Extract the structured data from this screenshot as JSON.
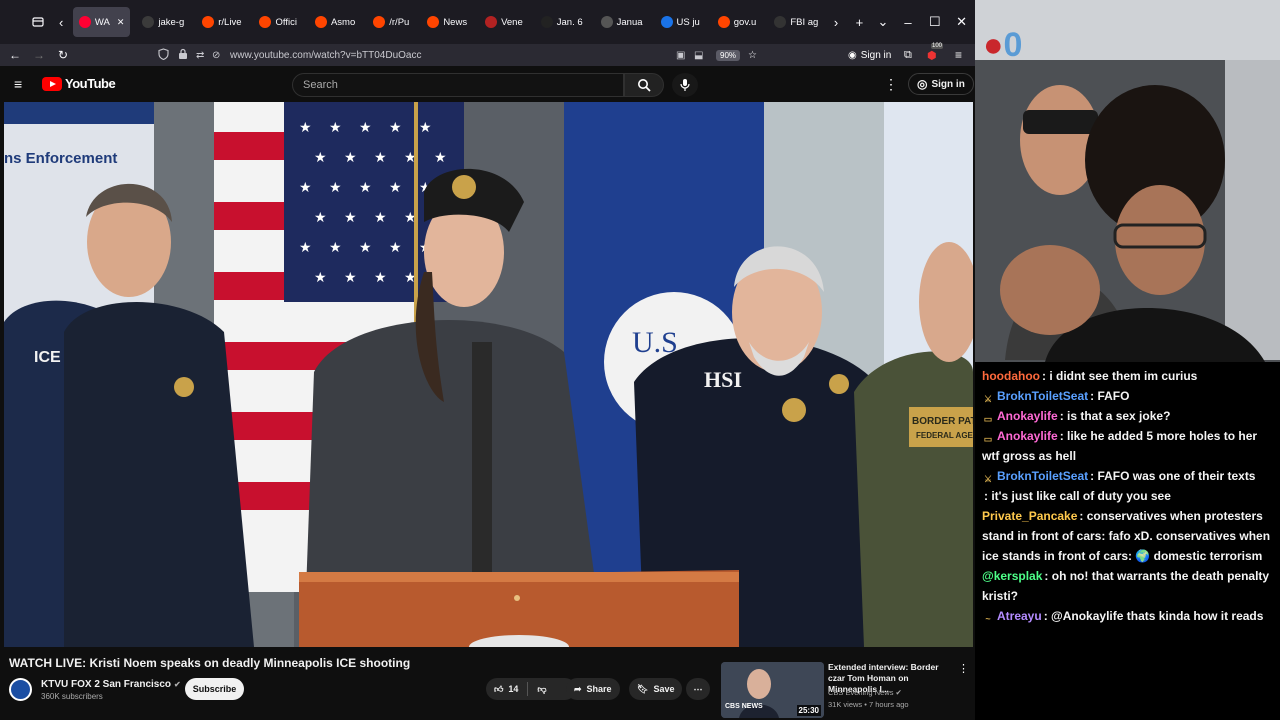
{
  "browser": {
    "tabs": [
      {
        "label": "WA",
        "favicon_color": "#ff0033",
        "active": true
      },
      {
        "label": "jake-g",
        "favicon_color": "#3b3b3b"
      },
      {
        "label": "r/Live",
        "favicon_color": "#ff4500"
      },
      {
        "label": "Offici",
        "favicon_color": "#ff4500"
      },
      {
        "label": "Asmo",
        "favicon_color": "#ff4500"
      },
      {
        "label": "/r/Pu",
        "favicon_color": "#ff4500"
      },
      {
        "label": "News",
        "favicon_color": "#ff4500"
      },
      {
        "label": "Vene",
        "favicon_color": "#b22222"
      },
      {
        "label": "Jan. 6",
        "favicon_color": "#222222"
      },
      {
        "label": "Janua",
        "favicon_color": "#555555"
      },
      {
        "label": "US ju",
        "favicon_color": "#1a73e8"
      },
      {
        "label": "gov.u",
        "favicon_color": "#ff4500"
      },
      {
        "label": "FBI ag",
        "favicon_color": "#333333"
      }
    ],
    "url": "www.youtube.com/watch?v=bTT04DuOacc",
    "zoom": "90%",
    "signin_label": "Sign in",
    "extension_badge": "100"
  },
  "youtube": {
    "logo_text": "YouTube",
    "search_placeholder": "Search",
    "signin_label": "Sign in",
    "video": {
      "title": "WATCH LIVE: Kristi Noem speaks on deadly Minneapolis ICE shooting",
      "channel": "KTVU FOX 2 San Francisco",
      "subscribers": "360K subscribers",
      "subscribe_label": "Subscribe",
      "likes": "14",
      "share_label": "Share",
      "save_label": "Save",
      "scene": {
        "banner_text": "ns Enforcement",
        "jacket_ice": "ICE",
        "jacket_hsi": "HSI",
        "patch_border_patrol": "BORDER PATROL",
        "patch_federal_agent": "FEDERAL AGENT"
      }
    },
    "recommended": {
      "title": "Extended interview: Border czar Tom Homan on Minneapolis I...",
      "channel": "CBS Evening News",
      "meta": "31K views • 7 hours ago",
      "duration": "25:30",
      "thumb_logo": "CBS NEWS"
    }
  },
  "stream": {
    "webcam_logo": "0",
    "chat": [
      {
        "user": "hoodahoo",
        "color": "#ff6a3d",
        "badge": "",
        "text": ": i didnt see them im curius"
      },
      {
        "user": "BroknToiletSeat",
        "color": "#5aa0ff",
        "badge": "⚔",
        "text": ": FAFO"
      },
      {
        "user": "Anokaylife",
        "color": "#ff6ad5",
        "badge": "▭",
        "text": ": is that a sex joke?"
      },
      {
        "user": "Anokaylife",
        "color": "#ff6ad5",
        "badge": "▭",
        "text": ": like he added 5 more holes to her wtf gross as hell"
      },
      {
        "user": "BroknToiletSeat",
        "color": "#5aa0ff",
        "badge": "⚔",
        "text": ": FAFO was one of their texts"
      },
      {
        "user": "",
        "color": "#000000",
        "badge": "",
        "text": ": it's just like call of duty you see"
      },
      {
        "user": "Private_Pancake",
        "color": "#ffc94d",
        "badge": "",
        "text": ": conservatives when protesters stand in front of cars: fafo xD. conservatives when ice stands in front of cars: 🌍 domestic terrorism"
      },
      {
        "user": "@kersplak",
        "color": "#4dff88",
        "badge": "",
        "text": ": oh no! that warrants the death penalty kristi?"
      },
      {
        "user": "Atreayu",
        "color": "#b48cff",
        "badge": "~",
        "text": ": @Anokaylife thats kinda how it reads"
      }
    ]
  }
}
